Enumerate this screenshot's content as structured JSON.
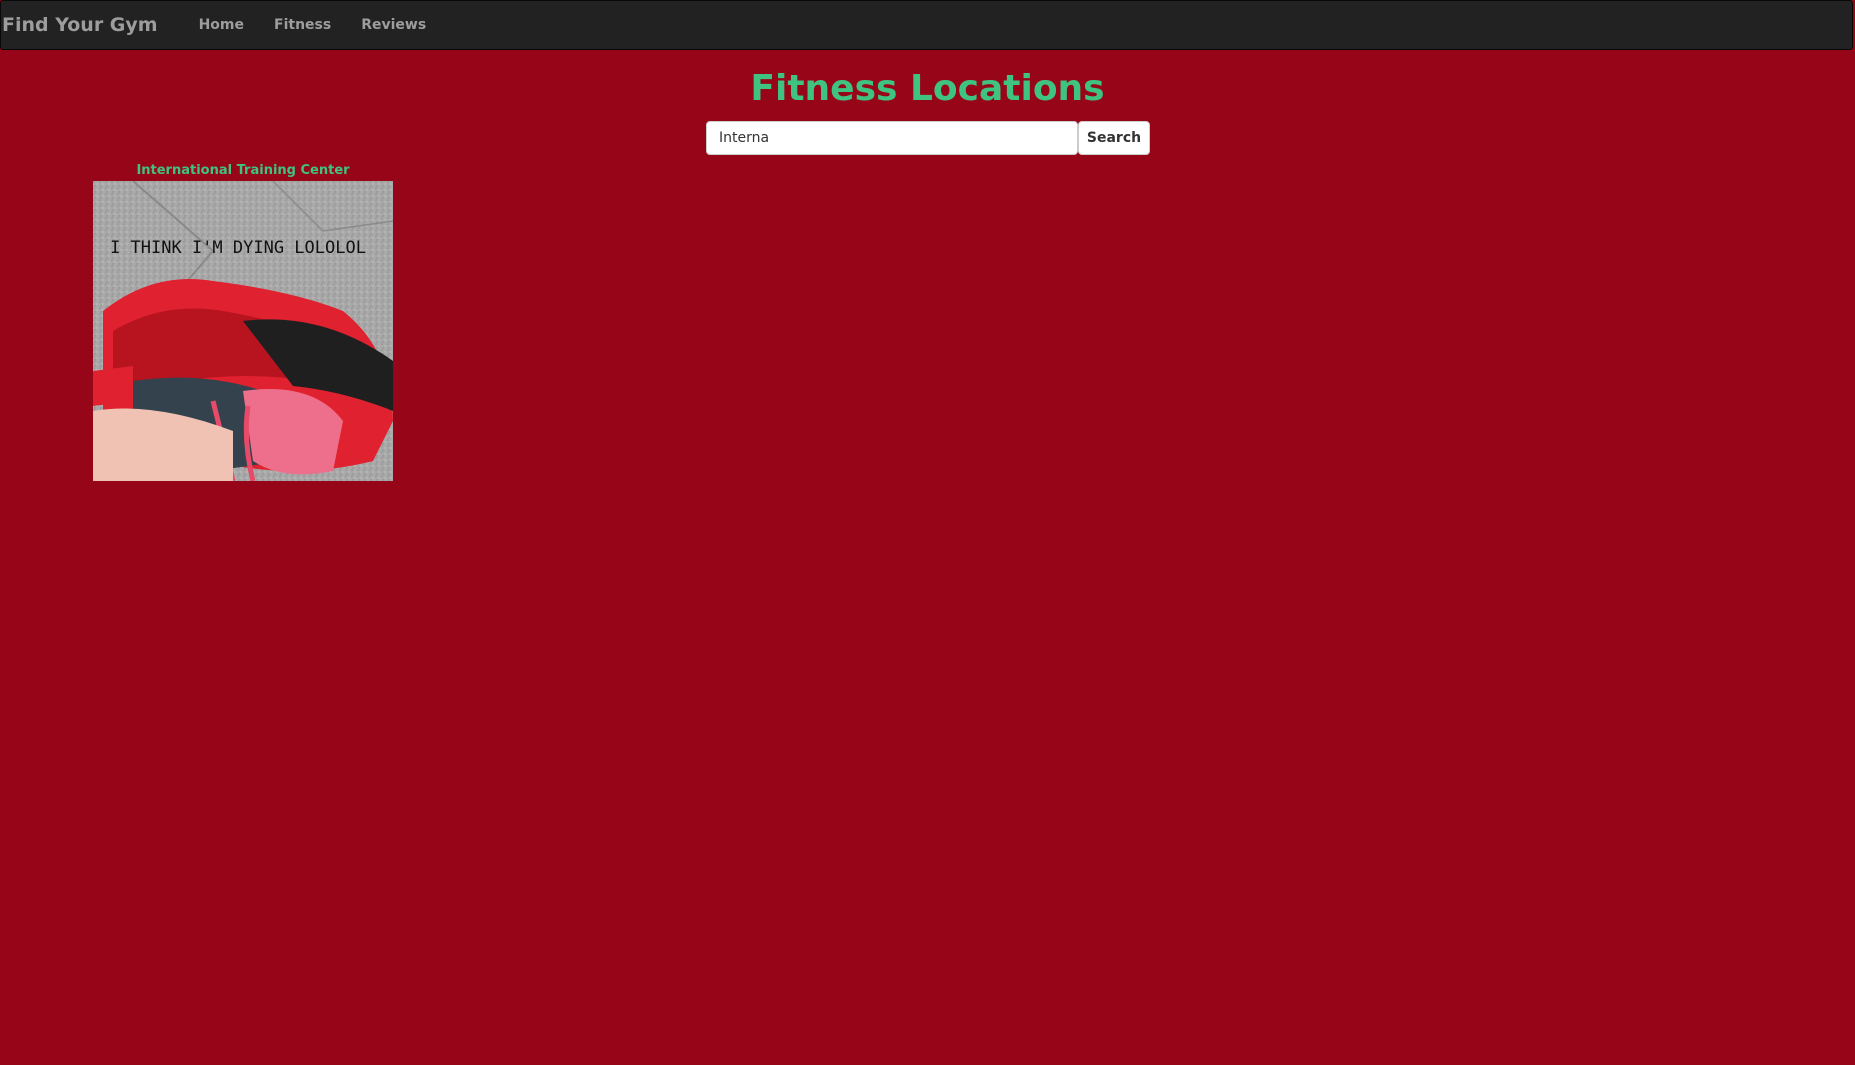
{
  "navbar": {
    "brand": "Find Your Gym",
    "links": [
      "Home",
      "Fitness",
      "Reviews"
    ]
  },
  "page": {
    "title": "Fitness Locations"
  },
  "search": {
    "value": "Interna",
    "button_label": "Search"
  },
  "results": [
    {
      "name": "International Training Center",
      "image_caption": "I THINK I'M DYING LOLOLOL"
    }
  ],
  "colors": {
    "background": "#970618",
    "navbar": "#222222",
    "accent": "#3fc380"
  }
}
